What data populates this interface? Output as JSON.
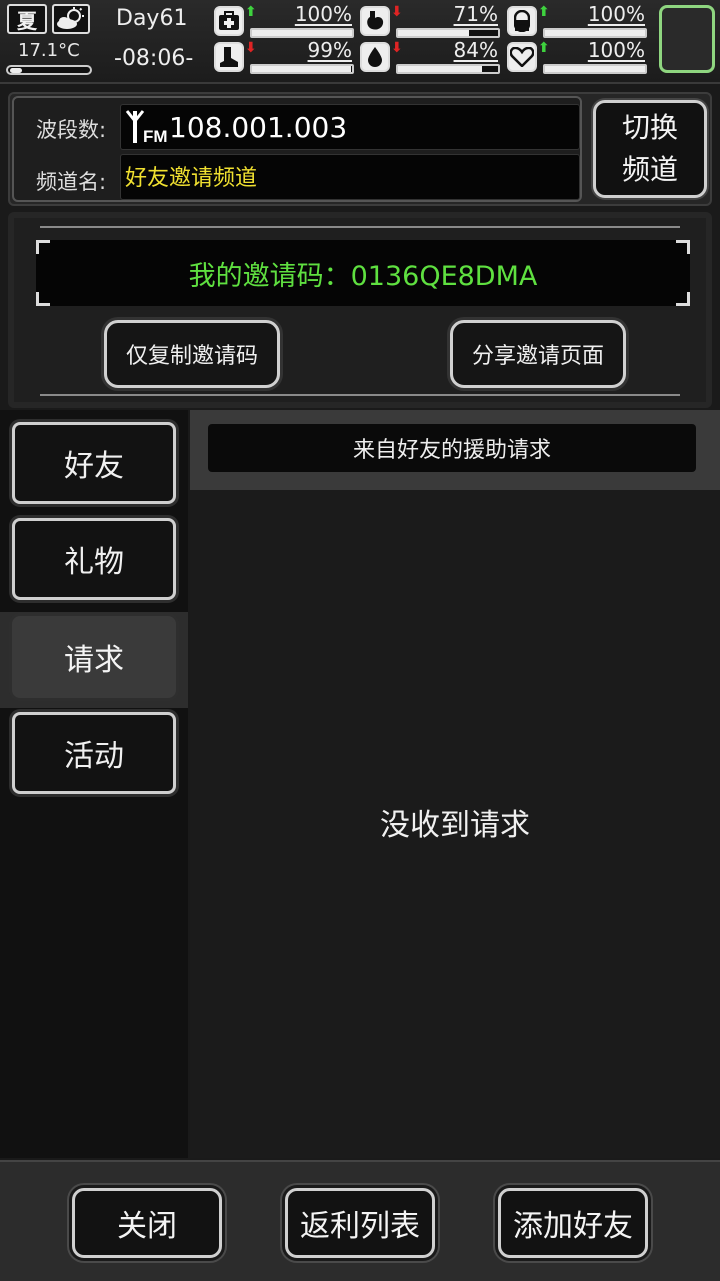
{
  "status": {
    "season": "夏",
    "temperature": "17.1°C",
    "temperature_level": 0.1,
    "day": "Day61",
    "clock": "-08:06-",
    "stats": [
      {
        "icon": "first-aid-icon",
        "trend": "up",
        "percent": "100%",
        "value": 1.0
      },
      {
        "icon": "stomach-icon",
        "trend": "down",
        "percent": "71%",
        "value": 0.71
      },
      {
        "icon": "pill-icon",
        "trend": "up",
        "percent": "100%",
        "value": 1.0
      },
      {
        "icon": "boot-icon",
        "trend": "down",
        "percent": "99%",
        "value": 0.99
      },
      {
        "icon": "water-drop-icon",
        "trend": "down",
        "percent": "84%",
        "value": 0.84
      },
      {
        "icon": "heart-icon",
        "trend": "up",
        "percent": "100%",
        "value": 1.0
      }
    ],
    "colors": {
      "up": "#3ed23e",
      "down": "#e02424",
      "slot_border": "#8fd680"
    }
  },
  "channel": {
    "band_label": "波段数:",
    "frequency": "108.001.003",
    "fm_label": "FM",
    "name_label": "频道名:",
    "name": "好友邀请频道",
    "switch_label": "切换\n频道"
  },
  "invite": {
    "code_label": "我的邀请码：0136QE8DMA",
    "copy_button": "仅复制邀请码",
    "share_button": "分享邀请页面"
  },
  "sidebar": {
    "items": [
      {
        "label": "好友",
        "active": false
      },
      {
        "label": "礼物",
        "active": false
      },
      {
        "label": "请求",
        "active": true
      },
      {
        "label": "活动",
        "active": false
      }
    ]
  },
  "content": {
    "title": "来自好友的援助请求",
    "empty_message": "没收到请求"
  },
  "bottom": {
    "close": "关闭",
    "rebate_list": "返利列表",
    "add_friend": "添加好友"
  }
}
